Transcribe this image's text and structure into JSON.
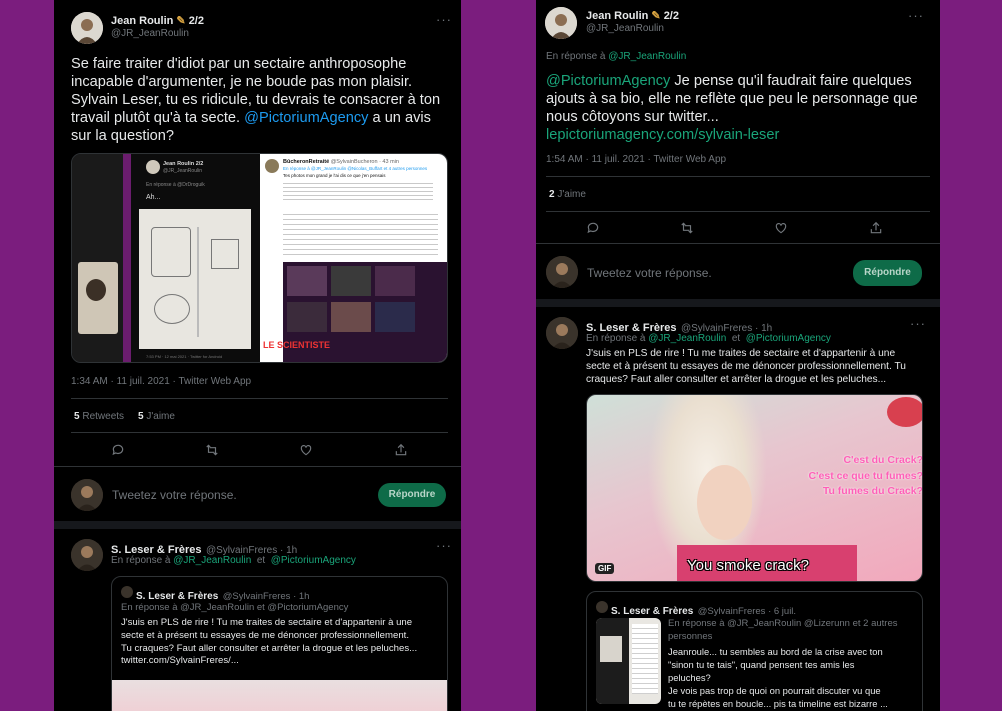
{
  "left_tweet": {
    "author": "Jean Roulin",
    "thread": "2/2",
    "handle": "@JR_JeanRoulin",
    "text_lines": [
      "Se faire traiter d'idiot par un sectaire anthroposophe",
      "incapable d'argumenter, je ne boude pas mon plaisir.",
      "Sylvain Leser, tu es ridicule, tu devrais te consacrer à ton"
    ],
    "text_line4_pre": "travail plutôt qu'à ta secte. ",
    "text_line4_mention": "@PictoriumAgency",
    "text_line4_post": " a un avis",
    "text_line5": "sur la question?",
    "timestamp": "1:34 AM · 11 juil. 2021 · Twitter Web App",
    "retweets_count": "5",
    "retweets_label": "Retweets",
    "likes_count": "5",
    "likes_label": "J'aime",
    "embedded_author": "Jean Roulin",
    "embedded_thread": "2/2",
    "embedded_handle": "@JR_JeanRoulin",
    "embedded_reply": "En réponse à @DrDroguik",
    "embedded_text": "Ah...",
    "embedded_time": "7:53 PM · 12 mai 2021 · Twitter for Android",
    "embedded_right_author": "BûcheronRetraité",
    "embedded_right_handle": "@SylvainBucheron · 43 min",
    "embedded_right_reply": "En réponse à @JR_JeanRoulin @Nicolas_Buffart et 4 autres personnes",
    "embedded_right_text": "Tes photos mon grand je l'ai dis ce que j'en pensais",
    "embedded_caption": "LE SCIENTISTE"
  },
  "left_reply_box": {
    "placeholder": "Tweetez votre réponse.",
    "button": "Répondre"
  },
  "left_reply_tweet": {
    "author": "S. Leser & Frères",
    "handle": "@SylvainFreres · 1h",
    "reply_prefix": "En réponse à",
    "reply_to_1": "@JR_JeanRoulin",
    "reply_and": "et",
    "reply_to_2": "@PictoriumAgency",
    "quote_author": "S. Leser & Frères",
    "quote_handle": "@SylvainFreres · 1h",
    "quote_reply": "En réponse à @JR_JeanRoulin  et  @PictoriumAgency",
    "quote_lines": [
      "J'suis en PLS de rire ! Tu me traites de sectaire et d'appartenir à une",
      "secte et à présent tu essayes de me dénoncer professionnellement.",
      "Tu craques? Faut aller consulter et arrêter la drogue et les peluches...",
      "twitter.com/SylvainFreres/..."
    ]
  },
  "right_tweet": {
    "author": "Jean Roulin",
    "thread": "2/2",
    "handle": "@JR_JeanRoulin",
    "reply_prefix": "En réponse à",
    "reply_to": "@JR_JeanRoulin",
    "mention": "@PictoriumAgency",
    "text_line1_post": " Je pense qu'il faudrait faire quelques",
    "text_line2": "ajouts à sa bio, elle ne reflète que peu le personnage que",
    "text_line3": "nous côtoyons sur twitter...",
    "link": "lepictoriumagency.com/sylvain-leser",
    "timestamp": "1:54 AM · 11 juil. 2021 · Twitter Web App",
    "likes_count": "2",
    "likes_label": "J'aime"
  },
  "right_reply_box": {
    "placeholder": "Tweetez votre réponse.",
    "button": "Répondre"
  },
  "right_reply_tweet": {
    "author": "S. Leser & Frères",
    "handle": "@SylvainFreres · 1h",
    "reply_prefix": "En réponse à",
    "reply_to_1": "@JR_JeanRoulin",
    "reply_and": "et",
    "reply_to_2": "@PictoriumAgency",
    "lines": [
      "J'suis en PLS de rire ! Tu me traites de sectaire et d'appartenir à une",
      "secte et à présent tu essayes de me dénoncer professionnellement. Tu",
      "craques? Faut aller consulter et arrêter la drogue et les peluches..."
    ],
    "gif_lines": [
      "C'est du Crack?",
      "C'est ce que tu fumes?",
      "Tu fumes du Crack?"
    ],
    "gif_caption": "You smoke crack?",
    "gif_badge": "GIF",
    "quote_author": "S. Leser & Frères",
    "quote_handle": "@SylvainFreres · 6 juil.",
    "quote_reply_line1": "En réponse à @JR_JeanRoulin @Lizerunn  et 2 autres",
    "quote_reply_line2": "personnes",
    "quote_lines": [
      "Jeanroule... tu sembles au bord de la crise avec ton",
      "\"sinon tu te tais\", quand pensent tes amis les",
      "peluches?",
      "Je vois pas trop de quoi on pourrait discuter vu que",
      "tu te répètes en boucle... pis ta timeline est bizarre ..."
    ]
  },
  "colors": {
    "background": "#7b1d7e",
    "panel": "#000000",
    "link": "#1d9bf0",
    "reply_button": "#0e6b48"
  }
}
